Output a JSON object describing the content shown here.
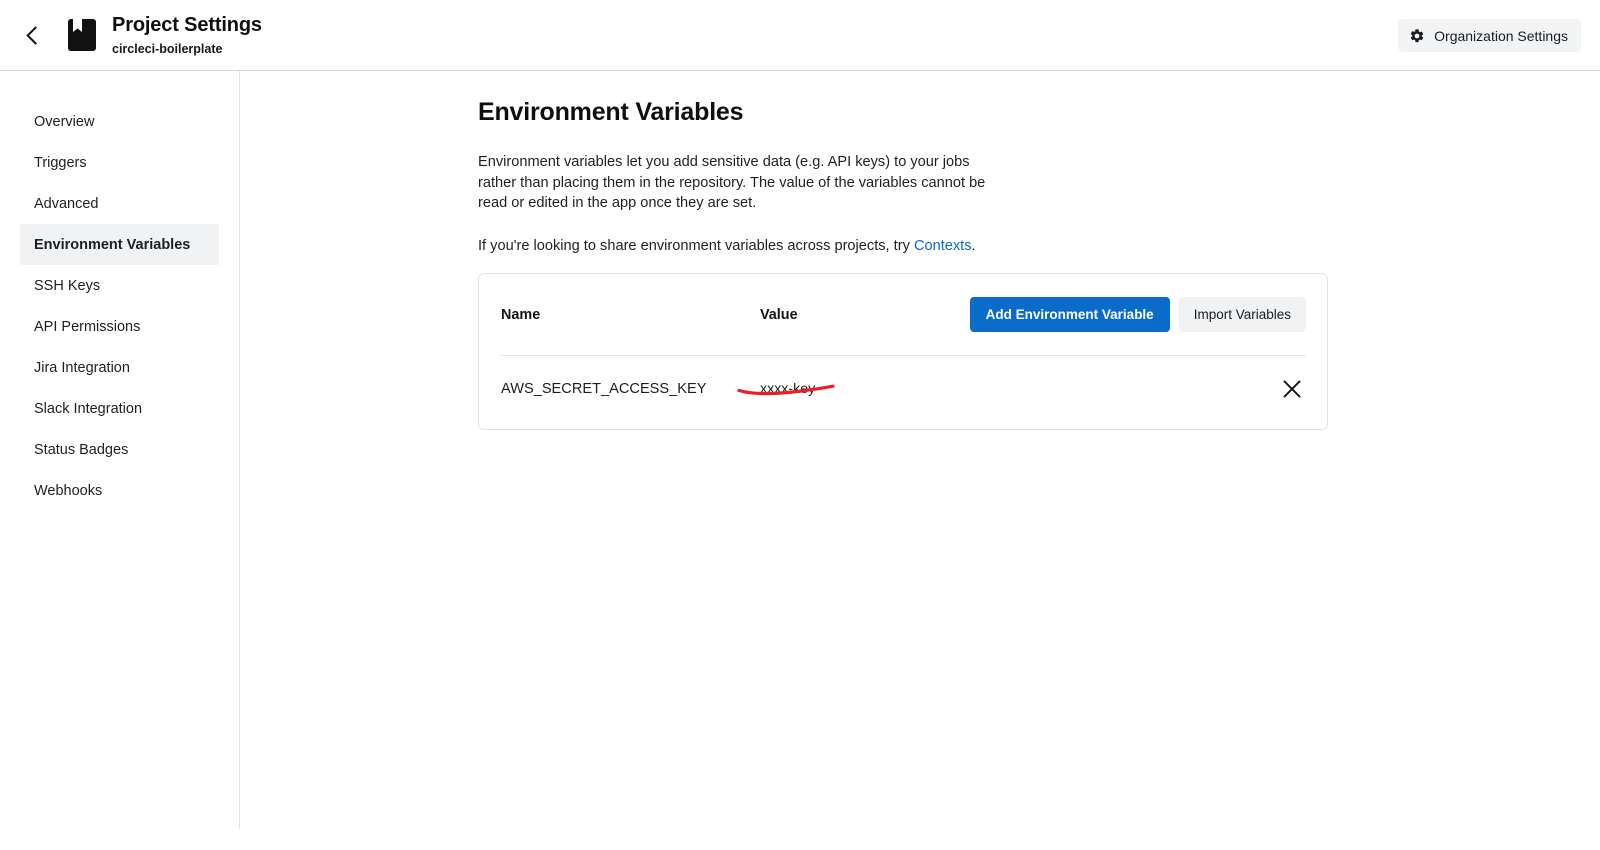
{
  "header": {
    "back_icon": "chevron-left-icon",
    "project_icon": "project-bookmark-icon",
    "title": "Project Settings",
    "subtitle": "circleci-boilerplate",
    "org_button": {
      "label": "Organization Settings",
      "icon": "gear-icon"
    }
  },
  "sidebar": {
    "items": [
      {
        "label": "Overview",
        "active": false
      },
      {
        "label": "Triggers",
        "active": false
      },
      {
        "label": "Advanced",
        "active": false
      },
      {
        "label": "Environment Variables",
        "active": true
      },
      {
        "label": "SSH Keys",
        "active": false
      },
      {
        "label": "API Permissions",
        "active": false
      },
      {
        "label": "Jira Integration",
        "active": false
      },
      {
        "label": "Slack Integration",
        "active": false
      },
      {
        "label": "Status Badges",
        "active": false
      },
      {
        "label": "Webhooks",
        "active": false
      }
    ]
  },
  "main": {
    "page_title": "Environment Variables",
    "description": "Environment variables let you add sensitive data (e.g. API keys) to your jobs rather than placing them in the repository. The value of the variables cannot be read or edited in the app once they are set.",
    "contexts_note_prefix": "If you're looking to share environment variables across projects, try ",
    "contexts_link": "Contexts",
    "contexts_note_suffix": ".",
    "table": {
      "columns": [
        "Name",
        "Value"
      ],
      "header_name": "Name",
      "header_value": "Value",
      "add_button": "Add Environment Variable",
      "import_button": "Import Variables",
      "rows": [
        {
          "name": "AWS_SECRET_ACCESS_KEY",
          "value": "xxxx-key",
          "delete_icon": "close-x-icon"
        }
      ]
    }
  },
  "annotation": {
    "type": "hand-drawn-underline",
    "color": "#ee1c25",
    "target": "xxxx-key"
  },
  "colors": {
    "primary_blue": "#0b6bc9",
    "link_blue": "#0b68c9",
    "annotation_red": "#ee1c25",
    "active_item_bg": "#f1f2f3",
    "border": "#e1e2e4"
  }
}
